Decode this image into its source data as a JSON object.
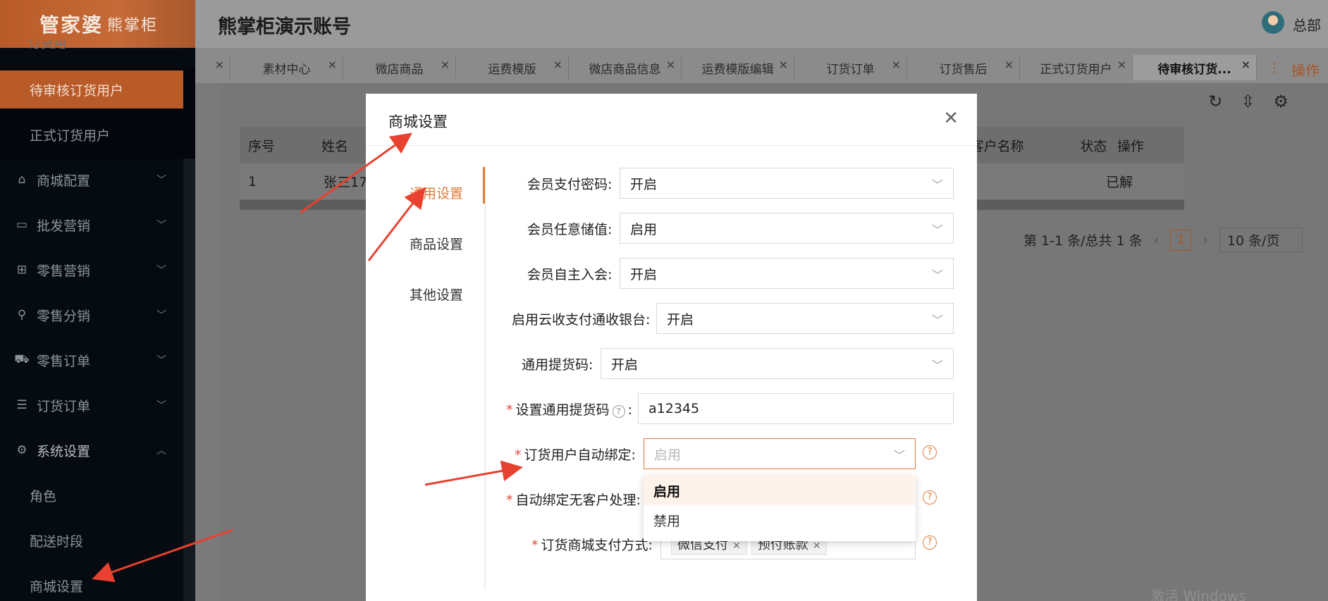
{
  "sidebar": {
    "logo": "管家婆",
    "logo_sub": "熊掌柜",
    "partial_item": "订货用",
    "items": [
      {
        "label": "待审核订货用户",
        "active": true
      },
      {
        "label": "正式订货用户"
      },
      {
        "label": "商城配置",
        "icon": "shop-icon"
      },
      {
        "label": "批发营销",
        "icon": "card-icon"
      },
      {
        "label": "零售营销",
        "icon": "gift-icon"
      },
      {
        "label": "零售分销",
        "icon": "org-icon"
      },
      {
        "label": "零售订单",
        "icon": "cart-icon"
      },
      {
        "label": "订货订单",
        "icon": "list-icon"
      },
      {
        "label": "系统设置",
        "icon": "gear-icon"
      },
      {
        "label": "角色"
      },
      {
        "label": "配送时段"
      },
      {
        "label": "商城设置"
      }
    ]
  },
  "header": {
    "title": "熊掌柜演示账号",
    "user": "总部"
  },
  "tabs": {
    "items": [
      "素材中心",
      "微店商品",
      "运费模版",
      "微店商品信息",
      "运费模版编辑",
      "订货订单",
      "订货售后",
      "正式订货用户",
      "待审核订货..."
    ],
    "ops": "操作"
  },
  "table": {
    "headers": [
      "序号",
      "姓名",
      "联客户名称",
      "状态",
      "操作"
    ],
    "row": [
      "1",
      "张三17",
      "已解"
    ]
  },
  "pager": {
    "summary": "第 1-1 条/总共 1 条",
    "current": "1",
    "size": "10 条/页"
  },
  "watermark": "激活 Windows",
  "modal": {
    "title": "商城设置",
    "nav": [
      "通用设置",
      "商品设置",
      "其他设置"
    ],
    "fields": [
      {
        "label": "会员支付密码:",
        "value": "开启"
      },
      {
        "label": "会员任意储值:",
        "value": "启用"
      },
      {
        "label": "会员自主入会:",
        "value": "开启"
      },
      {
        "label": "启用云收支付通收银台:",
        "value": "开启"
      },
      {
        "label": "通用提货码:",
        "value": "开启"
      },
      {
        "label": "设置通用提货码",
        "value": "a12345"
      },
      {
        "label": "订货用户自动绑定:",
        "placeholder": "启用"
      },
      {
        "label": "自动绑定无客户处理:"
      },
      {
        "label": "订货商城支付方式:",
        "tags": [
          "微信支付",
          "预付账款"
        ]
      }
    ],
    "dropdown": [
      "启用",
      "禁用"
    ]
  },
  "colors": {
    "accent": "#e07b3a",
    "sidebar_bg": "#060b12",
    "arrow": "#e8412f"
  }
}
